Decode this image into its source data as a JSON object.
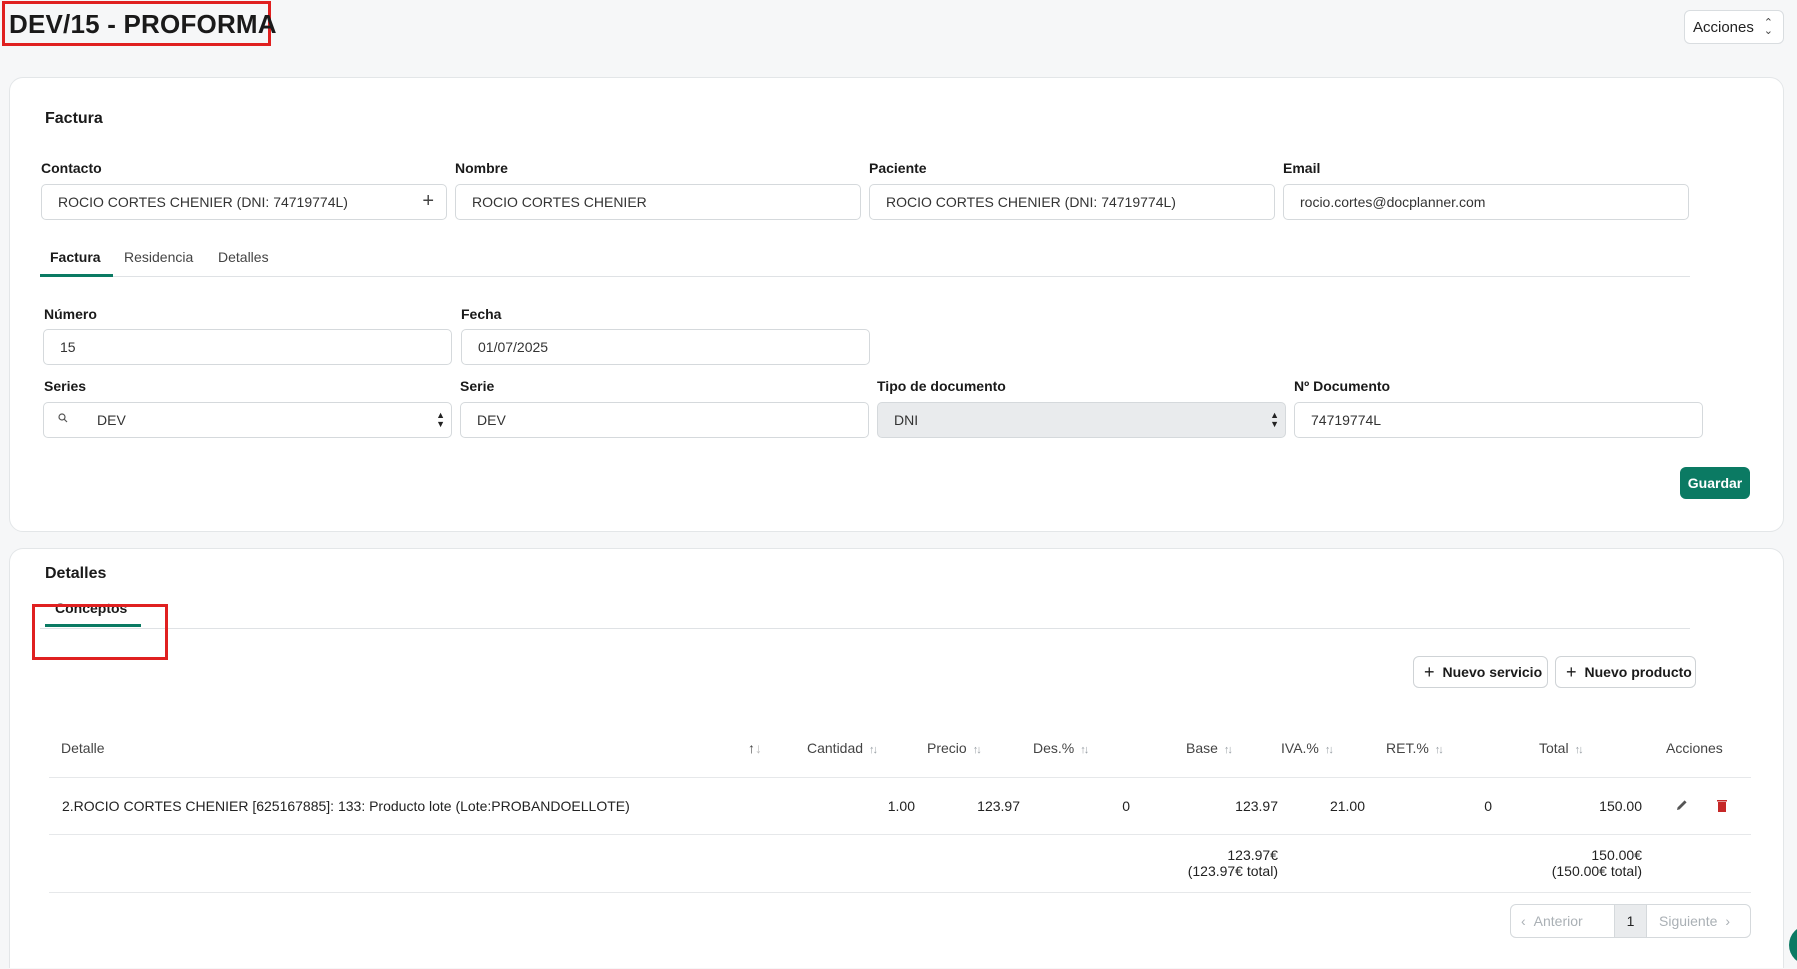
{
  "header": {
    "title": "DEV/15 - PROFORMA",
    "acciones": "Acciones"
  },
  "factura_card": {
    "title": "Factura",
    "contacto": {
      "label": "Contacto",
      "value": "ROCIO CORTES CHENIER (DNI: 74719774L)"
    },
    "nombre": {
      "label": "Nombre",
      "value": "ROCIO CORTES CHENIER"
    },
    "paciente": {
      "label": "Paciente",
      "value": "ROCIO CORTES CHENIER (DNI: 74719774L)"
    },
    "email": {
      "label": "Email",
      "value": "rocio.cortes@docplanner.com"
    },
    "tabs": [
      {
        "label": "Factura",
        "active": true
      },
      {
        "label": "Residencia",
        "active": false
      },
      {
        "label": "Detalles",
        "active": false
      }
    ],
    "numero": {
      "label": "Número",
      "value": "15"
    },
    "fecha": {
      "label": "Fecha",
      "value": "01/07/2025"
    },
    "series": {
      "label": "Series",
      "value": "DEV"
    },
    "serie": {
      "label": "Serie",
      "value": "DEV"
    },
    "tipo_documento": {
      "label": "Tipo de documento",
      "value": "DNI"
    },
    "n_documento": {
      "label": "Nº Documento",
      "value": "74719774L"
    },
    "save_label": "Guardar"
  },
  "detalles_card": {
    "title": "Detalles",
    "tab": "Conceptos",
    "nuevo_servicio": "Nuevo servicio",
    "nuevo_producto": "Nuevo producto",
    "columns": [
      "Detalle",
      "Cantidad",
      "Precio",
      "Des.%",
      "Base",
      "IVA.%",
      "RET.%",
      "Total",
      "Acciones"
    ],
    "rows": [
      {
        "detalle": "2.ROCIO CORTES CHENIER [625167885]: 133: Producto lote (Lote:PROBANDOELLOTE)",
        "cantidad": "1.00",
        "precio": "123.97",
        "des": "0",
        "base": "123.97",
        "iva": "21.00",
        "ret": "0",
        "total": "150.00"
      }
    ],
    "totals": {
      "base": "123.97€",
      "base_total": "(123.97€ total)",
      "total": "150.00€",
      "total_total": "(150.00€ total)"
    },
    "pagination": {
      "prev": "Anterior",
      "page": "1",
      "next": "Siguiente"
    }
  },
  "colors": {
    "accent": "#0b7a63",
    "highlight": "#e02020",
    "delete": "#c62828"
  },
  "icons": [
    "plus-icon",
    "search-icon",
    "sort-icon",
    "edit-icon",
    "trash-icon",
    "chevron-left-icon",
    "chevron-right-icon"
  ]
}
